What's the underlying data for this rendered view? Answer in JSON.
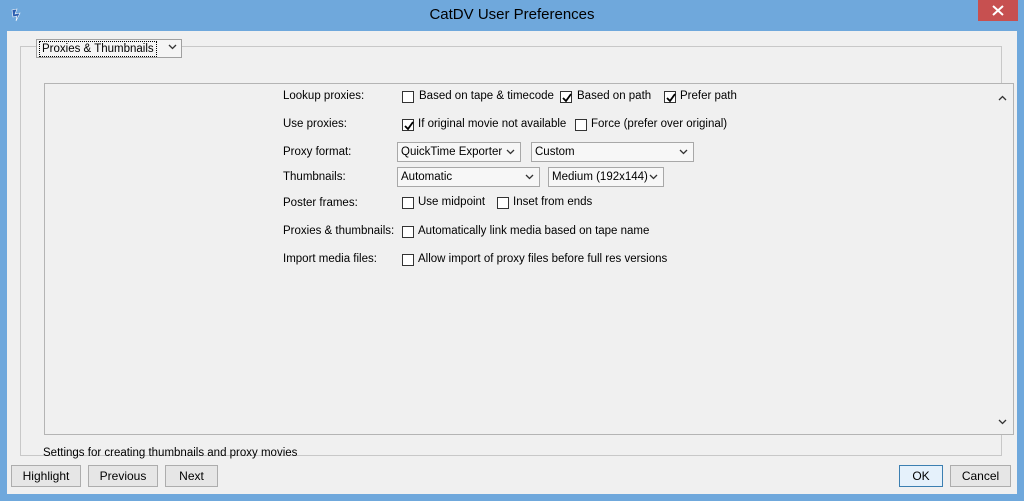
{
  "window": {
    "title": "CatDV User Preferences"
  },
  "section_select": {
    "value": "Proxies & Thumbnails"
  },
  "rows": {
    "lookup_proxies": {
      "label": "Lookup proxies:",
      "options": [
        {
          "label": "Based on tape & timecode",
          "checked": false
        },
        {
          "label": "Based on path",
          "checked": true
        },
        {
          "label": "Prefer path",
          "checked": true
        }
      ]
    },
    "use_proxies": {
      "label": "Use proxies:",
      "options": [
        {
          "label": "If original movie not available",
          "checked": true
        },
        {
          "label": "Force (prefer over original)",
          "checked": false
        }
      ]
    },
    "proxy_format": {
      "label": "Proxy format:",
      "select1": "QuickTime Exporter",
      "select2": "Custom"
    },
    "thumbnails": {
      "label": "Thumbnails:",
      "select1": "Automatic",
      "select2": "Medium (192x144)"
    },
    "poster_frames": {
      "label": "Poster frames:",
      "options": [
        {
          "label": "Use midpoint",
          "checked": false
        },
        {
          "label": "Inset from ends",
          "checked": false
        }
      ]
    },
    "proxies_thumbnails": {
      "label": "Proxies & thumbnails:",
      "option": {
        "label": "Automatically link media based on tape name",
        "checked": false
      }
    },
    "import_media": {
      "label": "Import media files:",
      "option": {
        "label": "Allow import of proxy files before full res versions",
        "checked": false
      }
    }
  },
  "status": "Settings for creating thumbnails and proxy movies",
  "buttons": {
    "highlight": "Highlight",
    "previous": "Previous",
    "next": "Next",
    "ok": "OK",
    "cancel": "Cancel"
  },
  "colors": {
    "titlebar": "#6fa8dc",
    "close": "#c75050",
    "dialog_bg": "#f0f0f0"
  },
  "icons": [
    "app-icon",
    "close-icon",
    "chevron-down-icon",
    "scroll-up-icon",
    "scroll-down-icon",
    "checkmark-icon"
  ]
}
